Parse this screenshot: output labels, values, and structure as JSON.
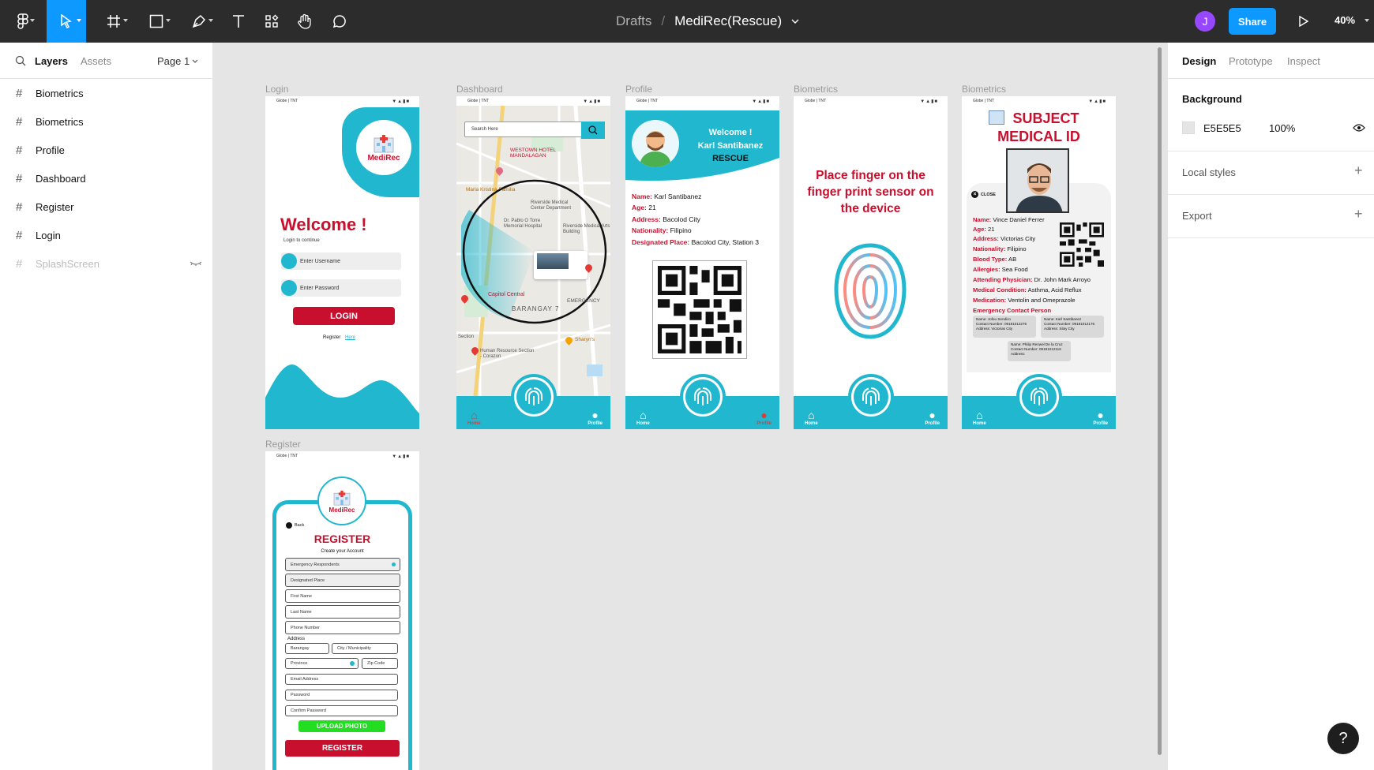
{
  "topbar": {
    "breadcrumb_parent": "Drafts",
    "breadcrumb_sep": "/",
    "file_name": "MediRec(Rescue)",
    "avatar_initial": "J",
    "share_label": "Share",
    "zoom": "40%"
  },
  "left_panel": {
    "tab_layers": "Layers",
    "tab_assets": "Assets",
    "page": "Page 1",
    "layers": [
      "Biometrics",
      "Biometrics",
      "Profile",
      "Dashboard",
      "Register",
      "Login",
      "SplashScreen"
    ]
  },
  "frames": {
    "labels": [
      "Login",
      "Dashboard",
      "Profile",
      "Biometrics",
      "Biometrics",
      "Register"
    ],
    "status_carrier": "Globe | TNT",
    "nav_home": "Home",
    "nav_profile": "Profile"
  },
  "login": {
    "logo": "MediRec",
    "welcome": "Welcome !",
    "subtitle": "Login to continue",
    "username_placeholder": "Enter Username",
    "password_placeholder": "Enter Password",
    "login_button": "LOGIN",
    "register_prompt": "Register",
    "register_link": "Here"
  },
  "dashboard": {
    "search_placeholder": "Search Here",
    "map_labels": [
      "WESTOWN HOTEL MANDALAGAN",
      "Maria Kristina Familia",
      "Riverside Medical Center Department",
      "Dr. Pablo O Torre Memorial Hospital",
      "Riverside Medical Arts Building",
      "Capitol Central",
      "BARANGAY 7",
      "EMERGENCY",
      "Human Resource Section - Corazon",
      "Sharyn's",
      "Section"
    ]
  },
  "profile": {
    "welcome": "Welcome !",
    "name_header": "Karl Santibanez",
    "role": "RESCUE",
    "fields": [
      {
        "k": "Name:",
        "v": "Karl Santibanez"
      },
      {
        "k": "Age:",
        "v": "21"
      },
      {
        "k": "Address:",
        "v": "Bacolod City"
      },
      {
        "k": "Nationality:",
        "v": "Filipino"
      },
      {
        "k": "Designated Place:",
        "v": "Bacolod City, Station 3"
      }
    ]
  },
  "biometrics": {
    "instruction": "Place finger on the finger print sensor on the device"
  },
  "medical_id": {
    "title_line1": "SUBJECT",
    "title_line2": "MEDICAL ID",
    "close": "CLOSE",
    "fields": [
      {
        "k": "Name:",
        "v": "Vince Daniel Ferrer"
      },
      {
        "k": "Age:",
        "v": "21"
      },
      {
        "k": "Address:",
        "v": "Victorias City"
      },
      {
        "k": "Nationality:",
        "v": "Filipino"
      },
      {
        "k": "Blood Type:",
        "v": "AB"
      },
      {
        "k": "Allergies:",
        "v": "Sea Food"
      },
      {
        "k": "Attending Physician:",
        "v": "Dr. John Mark Arroyo"
      },
      {
        "k": "Medical Condition:",
        "v": "Asthma, Acid Reflux"
      },
      {
        "k": "Medication:",
        "v": "Ventolin and Omeprazole"
      }
    ],
    "emergency_title": "Emergency Contact Person",
    "contacts": [
      {
        "name": "Name: Jofou Sendico",
        "number": "Contact Number: 09181012276",
        "address": "Address: Victorias City"
      },
      {
        "name": "Name: Karl Santibanez",
        "number": "Contact Number: 09181012176",
        "address": "Address: Silay City"
      },
      {
        "name": "Name: Philip Renwel De la Cruz",
        "number": "Contact Number: 09181012116",
        "address": "Address:"
      }
    ]
  },
  "register": {
    "back": "Back",
    "title": "REGISTER",
    "subtitle": "Create your Account",
    "fields": [
      "Emergency Respondents",
      "Designated Place",
      "First Name",
      "Last Name",
      "Phone Number"
    ],
    "address_label": "Address",
    "barangay": "Barangay",
    "city": "City / Municipality",
    "province": "Province",
    "zip": "Zip Code",
    "fields2": [
      "Email Address",
      "Password",
      "Confirm Password"
    ],
    "upload": "UPLOAD PHOTO",
    "submit": "REGISTER"
  },
  "right_panel": {
    "tab_design": "Design",
    "tab_prototype": "Prototype",
    "tab_inspect": "Inspect",
    "background_label": "Background",
    "bg_hex": "E5E5E5",
    "bg_opacity": "100%",
    "local_styles": "Local styles",
    "export": "Export"
  },
  "help": "?",
  "colors": {
    "accent": "#21b8cf",
    "brand_red": "#c8102e",
    "toolbar": "#2c2c2c",
    "selected_tool": "#0d99ff"
  }
}
